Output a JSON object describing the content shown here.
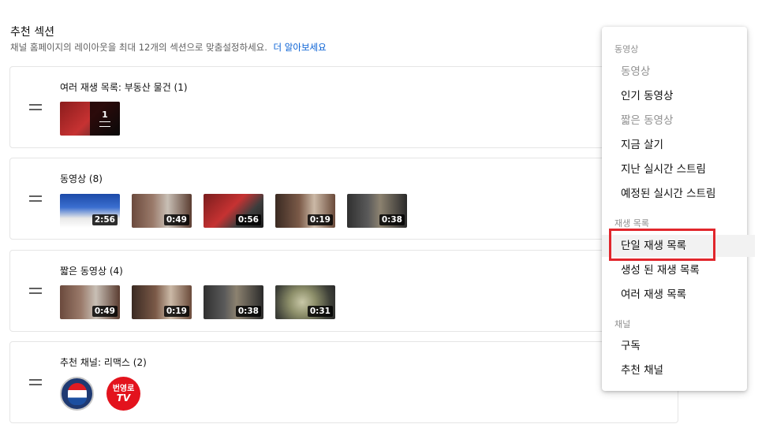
{
  "header": {
    "title": "추천 섹션",
    "description": "채널 홈페이지의 레이아웃을 최대 12개의 섹션으로 맞춤설정하세요.",
    "learn_more": "더 알아보세요"
  },
  "sections": [
    {
      "title": "여러 재생 목록: 부동산 물건 (1)",
      "playlist_count": "1"
    },
    {
      "title": "동영상 (8)",
      "durations": [
        "2:56",
        "0:49",
        "0:56",
        "0:19",
        "0:38"
      ]
    },
    {
      "title": "짧은 동영상 (4)",
      "durations": [
        "0:49",
        "0:19",
        "0:38",
        "0:31"
      ]
    },
    {
      "title": "추천 채널: 리맥스 (2)",
      "channel_avatar_text": [
        "번영로",
        "TV"
      ]
    }
  ],
  "menu": {
    "groups": [
      {
        "label": "동영상",
        "items": [
          {
            "label": "동영상",
            "disabled": true
          },
          {
            "label": "인기 동영상",
            "disabled": false
          },
          {
            "label": "짧은 동영상",
            "disabled": true
          },
          {
            "label": "지금 살기",
            "disabled": false
          },
          {
            "label": "지난 실시간 스트림",
            "disabled": false
          },
          {
            "label": "예정된 실시간 스트림",
            "disabled": false
          }
        ]
      },
      {
        "label": "재생 목록",
        "items": [
          {
            "label": "단일 재생 목록",
            "highlighted": true
          },
          {
            "label": "생성 된 재생 목록"
          },
          {
            "label": "여러 재생 목록"
          }
        ]
      },
      {
        "label": "채널",
        "items": [
          {
            "label": "구독"
          },
          {
            "label": "추천 채널"
          }
        ]
      }
    ]
  },
  "colors": {
    "link": "#065fd4",
    "highlight_border": "#e1262c",
    "disabled_text": "#909090"
  }
}
